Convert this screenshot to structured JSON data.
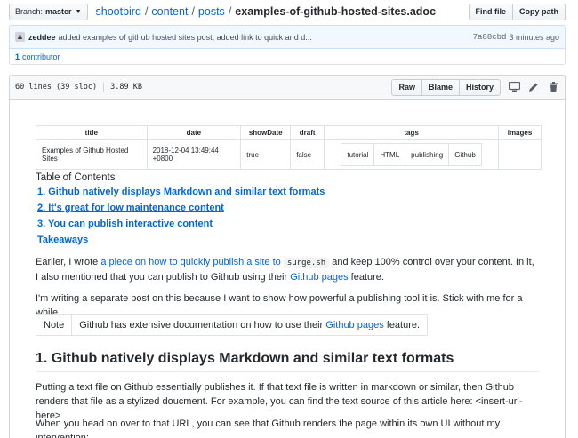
{
  "branch": {
    "label": "Branch:",
    "name": "master"
  },
  "breadcrumb": {
    "repo": "shootbird",
    "dir1": "content",
    "dir2": "posts",
    "file": "examples-of-github-hosted-sites.adoc",
    "sep": "/"
  },
  "header_buttons": {
    "find": "Find file",
    "copy": "Copy path"
  },
  "commit": {
    "author": "zeddee",
    "message": "added examples of github hosted sites post; added link to quick and d...",
    "sha": "7a88cbd",
    "time": "3 minutes ago"
  },
  "contributors": {
    "count": "1",
    "label": "contributor"
  },
  "file": {
    "lines": "60 lines (39 sloc)",
    "size": "3.89 KB",
    "raw": "Raw",
    "blame": "Blame",
    "history": "History"
  },
  "icons": {
    "desktop": "desktop-icon",
    "pencil": "pencil-icon",
    "trash": "trash-icon"
  },
  "meta_table": {
    "headers": [
      "title",
      "date",
      "showDate",
      "draft",
      "tags",
      "images"
    ],
    "title": "Examples of Github Hosted Sites",
    "date": "2018-12-04 13:49:44 +0800",
    "showDate": "true",
    "draft": "false",
    "tags": [
      "tutorial",
      "HTML",
      "publishing",
      "Github"
    ],
    "images": ""
  },
  "toc": {
    "label": "Table of Contents",
    "items": [
      "1. Github natively displays Markdown and similar text formats",
      "2. It's great for low maintenance content",
      "3. You can publish interactive content",
      "Takeaways"
    ]
  },
  "p1": {
    "a": "Earlier, I wrote ",
    "link": "a piece on how to quickly publish a site to",
    "code": "surge.sh",
    "b": " and keep 100% control over your content. In it, I also mentioned that you can publish to Github using their ",
    "link2": "Github pages",
    "c": " feature."
  },
  "p2": "I'm writing a separate post on this because I want to show how powerful a publishing tool it is. Stick with me for a while.",
  "note": {
    "label": "Note",
    "a": "Github has extensive documentation on how to use their ",
    "link": "Github pages",
    "b": " feature."
  },
  "h2": "1. Github natively displays Markdown and similar text formats",
  "p3": "Putting a text file on Github essentially publishes it. If that text file is written in markdown or similar, then Github renders that file as a stylized doucment. For example, you can find the text source of this article here: <insert-url-here>",
  "p4": "When you head on over to that URL, you can see that Github renders the page within its own UI without my intervention:"
}
